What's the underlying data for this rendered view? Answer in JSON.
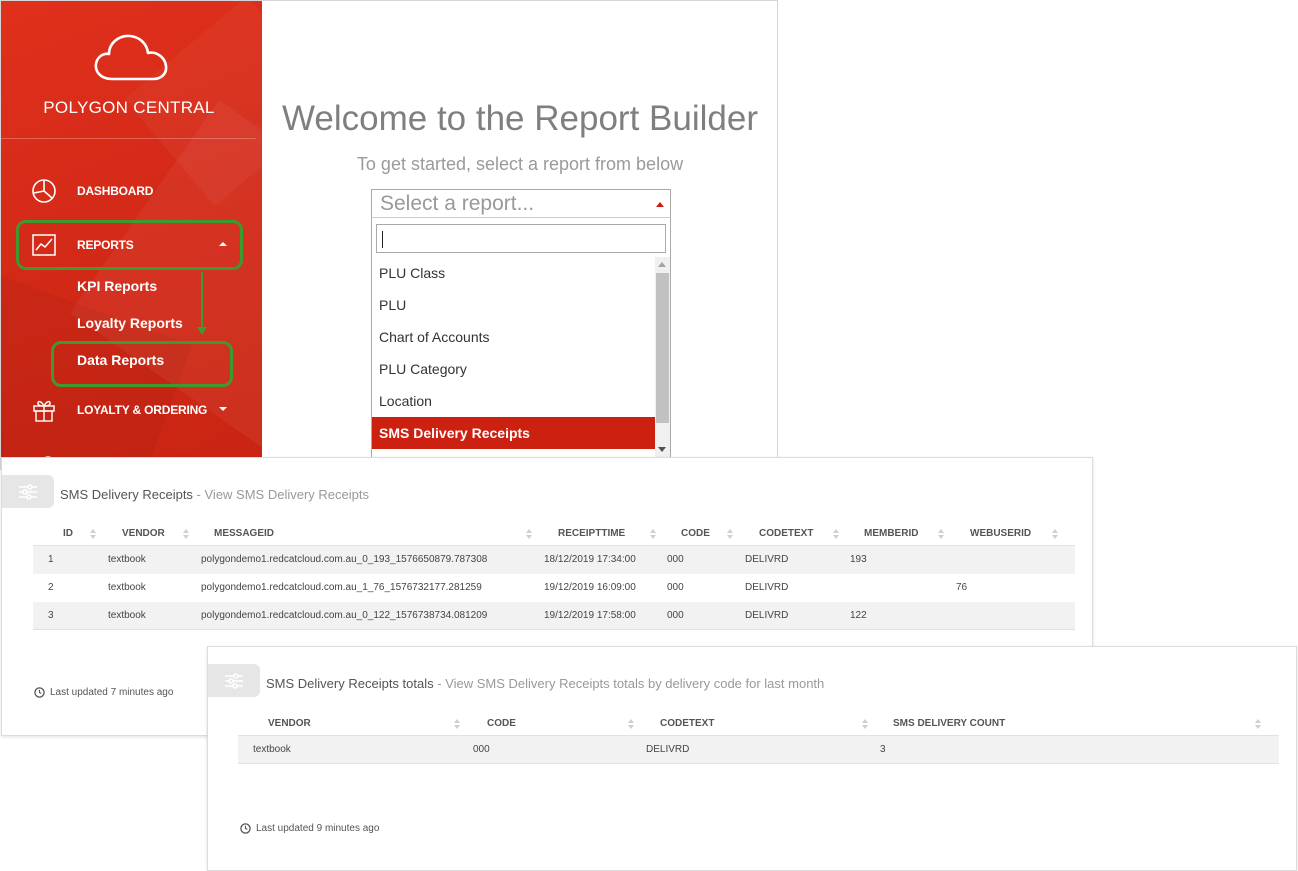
{
  "app": {
    "brand": "POLYGON CENTRAL",
    "colors": {
      "primary_red": "#d42a18",
      "highlight_green": "#3e9a2e",
      "selected_option": "#cc2111"
    }
  },
  "sidebar": {
    "items": [
      {
        "label": "DASHBOARD",
        "icon": "pie-chart-icon"
      },
      {
        "label": "REPORTS",
        "icon": "line-chart-icon",
        "expanded": true
      },
      {
        "label": "LOYALTY & ORDERING",
        "icon": "gift-icon",
        "expanded": false
      }
    ],
    "sub_items": [
      "KPI Reports",
      "Loyalty Reports",
      "Data Reports"
    ]
  },
  "main": {
    "title": "Welcome to the Report Builder",
    "subtitle": "To get started, select a report from below",
    "select": {
      "placeholder": "Select a report...",
      "search_value": "",
      "options": [
        "PLU Class",
        "PLU",
        "Chart of Accounts",
        "PLU Category",
        "Location",
        "SMS Delivery Receipts"
      ],
      "selected": "SMS Delivery Receipts"
    }
  },
  "report1": {
    "title": "SMS Delivery Receipts",
    "separator": " - ",
    "description": "View SMS Delivery Receipts",
    "columns": [
      "ID",
      "VENDOR",
      "MESSAGEID",
      "RECEIPTTIME",
      "CODE",
      "CODETEXT",
      "MEMBERID",
      "WEBUSERID"
    ],
    "rows": [
      {
        "id": "1",
        "vendor": "textbook",
        "messageid": "polygondemo1.redcatcloud.com.au_0_193_1576650879.787308",
        "receipttime": "18/12/2019 17:34:00",
        "code": "000",
        "codetext": "DELIVRD",
        "memberid": "193",
        "webuserid": ""
      },
      {
        "id": "2",
        "vendor": "textbook",
        "messageid": "polygondemo1.redcatcloud.com.au_1_76_1576732177.281259",
        "receipttime": "19/12/2019 16:09:00",
        "code": "000",
        "codetext": "DELIVRD",
        "memberid": "",
        "webuserid": "76"
      },
      {
        "id": "3",
        "vendor": "textbook",
        "messageid": "polygondemo1.redcatcloud.com.au_0_122_1576738734.081209",
        "receipttime": "19/12/2019 17:58:00",
        "code": "000",
        "codetext": "DELIVRD",
        "memberid": "122",
        "webuserid": ""
      }
    ],
    "footer": "Last updated 7 minutes ago"
  },
  "report2": {
    "title": "SMS Delivery Receipts totals",
    "separator": " - ",
    "description": "View SMS Delivery Receipts totals by delivery code for last month",
    "columns": [
      "VENDOR",
      "CODE",
      "CODETEXT",
      "SMS DELIVERY COUNT"
    ],
    "rows": [
      {
        "vendor": "textbook",
        "code": "000",
        "codetext": "DELIVRD",
        "count": "3"
      }
    ],
    "footer": "Last updated 9 minutes ago"
  }
}
